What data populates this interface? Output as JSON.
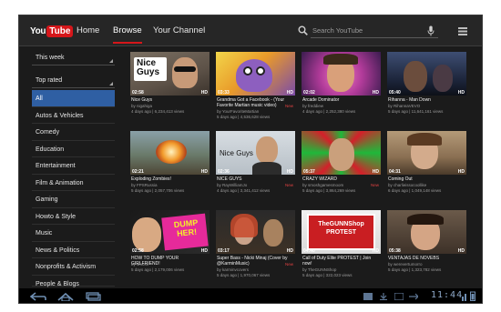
{
  "header": {
    "logo_you": "You",
    "logo_tube": "Tube",
    "tabs": [
      "Home",
      "Browse",
      "Your Channel"
    ],
    "active_tab": "Browse",
    "search_placeholder": "Search YouTube"
  },
  "sidebar": {
    "filters": [
      "This week",
      "Top rated"
    ],
    "categories": [
      "All",
      "Autos & Vehicles",
      "Comedy",
      "Education",
      "Entertainment",
      "Film & Animation",
      "Gaming",
      "Howto & Style",
      "Music",
      "News & Politics",
      "Nonprofits & Activism",
      "People & Blogs"
    ],
    "active_category": "All"
  },
  "videos": [
    {
      "title": "Nice Guys",
      "by": "by nigahiga",
      "stats": "4 days ago | 6,234,413 views",
      "duration": "02:58",
      "hd": "HD",
      "new": "",
      "thumb_text": "Nice\nGuys"
    },
    {
      "title": "Grandma Got a Facebook - (Your Favorite Martian music video)",
      "by": "by YourFavoriteMartian",
      "stats": "5 days ago | 4,536,628 views",
      "duration": "03:33",
      "hd": "HD",
      "new": "New",
      "thumb_text": ""
    },
    {
      "title": "Arcade Dominator",
      "by": "by freddiew",
      "stats": "4 days ago | 2,252,380 views",
      "duration": "02:02",
      "hd": "HD",
      "new": "",
      "thumb_text": ""
    },
    {
      "title": "Rihanna - Man Down",
      "by": "by RihannaVEVO",
      "stats": "5 days ago | 11,641,161 views",
      "duration": "05:40",
      "hd": "HD",
      "new": "",
      "thumb_text": ""
    },
    {
      "title": "Exploding Zombies!",
      "by": "by FPSRussia",
      "stats": "5 days ago | 2,057,706 views",
      "duration": "02:21",
      "hd": "HD",
      "new": "",
      "thumb_text": ""
    },
    {
      "title": "NICE GUYS",
      "by": "by RayWilliamJo",
      "stats": "4 days ago | 3,341,412 views",
      "duration": "02:36",
      "hd": "HD",
      "new": "New",
      "thumb_text": "Nice Guys"
    },
    {
      "title": "CRAZY WIZARD",
      "by": "by smoshgamesmoom",
      "stats": "5 days ago | 3,864,269 views",
      "duration": "05:37",
      "hd": "HD",
      "new": "New",
      "thumb_text": ""
    },
    {
      "title": "Coming Out",
      "by": "by charlieissocoollike",
      "stats": "6 days ago | 1,049,148 views",
      "duration": "04:31",
      "hd": "HD",
      "new": "",
      "thumb_text": ""
    },
    {
      "title": "HOW TO DUMP YOUR GIRLFRIEND!",
      "by": "by smosh",
      "stats": "5 days ago | 2,179,006 views",
      "duration": "02:58",
      "hd": "HD",
      "new": "",
      "thumb_text": "DUMP\nHER!"
    },
    {
      "title": "Super Bass - Nicki Minaj (Cover by @KarminMusic)",
      "by": "by karminvcovers",
      "stats": "5 days ago | 1,970,067 views",
      "duration": "03:17",
      "hd": "HD",
      "new": "New",
      "thumb_text": ""
    },
    {
      "title": "Call of Duty Elite PROTEST | Join now!",
      "by": "by TheGUNNShop",
      "stats": "5 days ago | 322,023 views",
      "duration": "04:40",
      "hd": "HD",
      "new": "",
      "thumb_text": "TheGUNNShop\nPROTEST"
    },
    {
      "title": "VENTAJAS DE NOVEBS",
      "by": "by werevertumorro",
      "stats": "5 days ago | 1,323,782 views",
      "duration": "05:38",
      "hd": "HD",
      "new": "",
      "thumb_text": ""
    }
  ],
  "system": {
    "clock": "11:44",
    "icons": [
      "back-icon",
      "home-icon",
      "recent-apps-icon"
    ]
  },
  "colors": {
    "accent": "#d6161a",
    "selection": "#2f5fa3",
    "background": "#1b1b1b",
    "new_badge": "#e04141"
  }
}
